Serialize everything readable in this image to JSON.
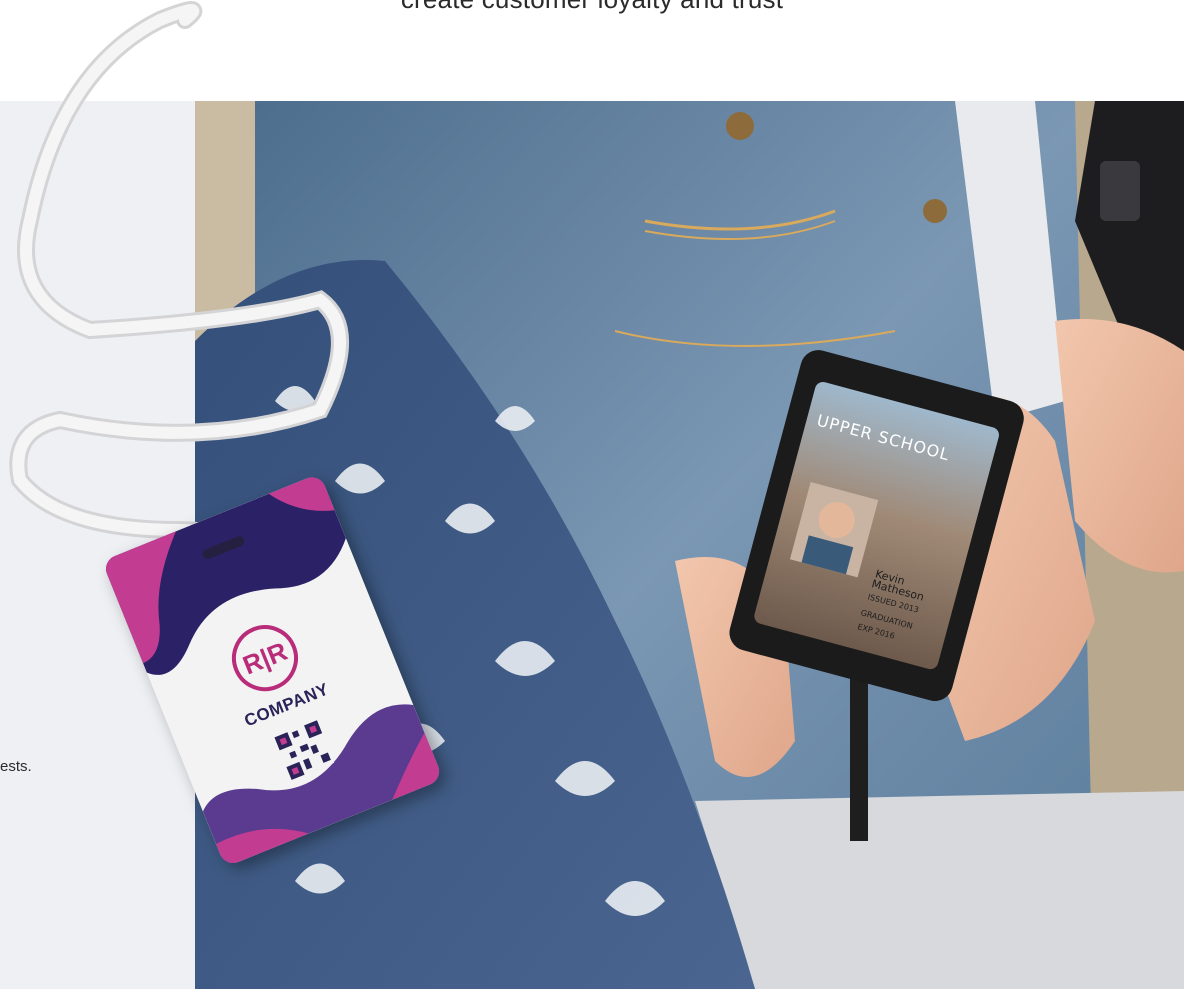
{
  "headline": "create customer loyalty and trust",
  "left_text": "ests.",
  "badge": {
    "logo_text": "R|R",
    "company": "COMPANY"
  },
  "id_card": {
    "school": "UPPER SCHOOL",
    "name_first": "Kevin",
    "name_last": "Matheson",
    "issued": "ISSUED 2013",
    "graduation": "GRADUATION",
    "exp": "EXP 2016"
  },
  "colors": {
    "panel": "#eef0f4",
    "badge_accent": "#b82c7a",
    "badge_dark": "#2a2358",
    "denim": "#6c8aa8",
    "fabric": "#3e5a80"
  }
}
